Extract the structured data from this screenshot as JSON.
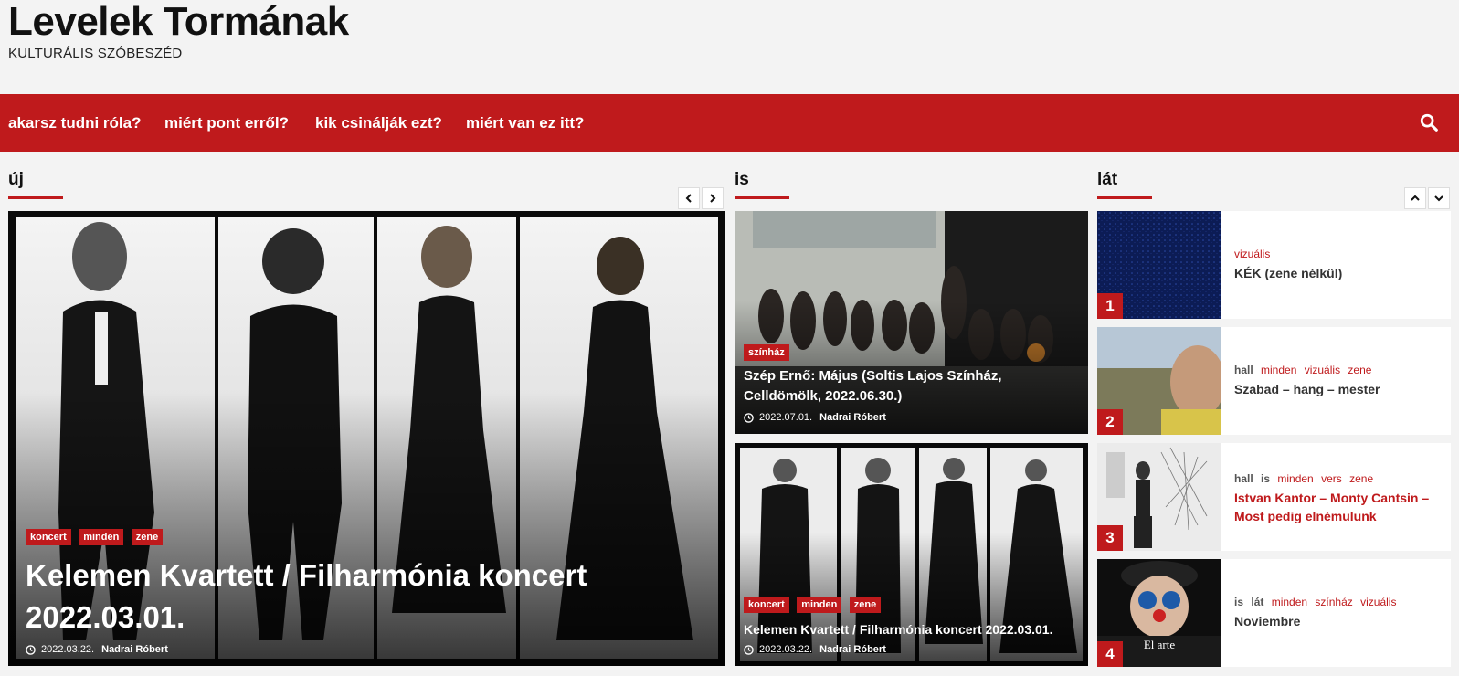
{
  "site": {
    "title": "Levelek Tormának",
    "tagline": "KULTURÁLIS SZÓBESZÉD"
  },
  "nav": {
    "items": [
      {
        "label": "akarsz tudni róla?"
      },
      {
        "label": "miért pont erről?"
      },
      {
        "label": "kik csinálják ezt?"
      },
      {
        "label": "miért van ez itt?"
      }
    ],
    "search_icon": "search-icon"
  },
  "colors": {
    "accent": "#bf1a1c",
    "background": "#f3f3f3"
  },
  "sections": {
    "uj": {
      "title": "új",
      "featured": {
        "tags": [
          "koncert",
          "minden",
          "zene"
        ],
        "headline": "Kelemen Kvartett / Filharmónia koncert 2022.03.01.",
        "date": "2022.03.22.",
        "author": "Nadrai Róbert"
      }
    },
    "is": {
      "title": "is",
      "posts": [
        {
          "tags": [
            "színház"
          ],
          "headline": "Szép Ernő: Május (Soltis Lajos Színház, Celldömölk, 2022.06.30.)",
          "date": "2022.07.01.",
          "author": "Nadrai Róbert"
        },
        {
          "tags": [
            "koncert",
            "minden",
            "zene"
          ],
          "headline": "Kelemen Kvartett / Filharmónia koncert 2022.03.01.",
          "date": "2022.03.22.",
          "author": "Nadrai Róbert"
        }
      ]
    },
    "lat": {
      "title": "lát",
      "items": [
        {
          "num": "1",
          "grey": [],
          "red": [
            "vizuális"
          ],
          "title": "KÉK (zene nélkül)"
        },
        {
          "num": "2",
          "grey": [
            "hall"
          ],
          "red": [
            "minden",
            "vizuális",
            "zene"
          ],
          "title": "Szabad – hang – mester"
        },
        {
          "num": "3",
          "grey": [
            "hall",
            "is"
          ],
          "red": [
            "minden",
            "vers",
            "zene"
          ],
          "title": "Istvan Kantor – Monty Cantsin – Most pedig elnémulunk"
        },
        {
          "num": "4",
          "grey": [
            "is",
            "lát"
          ],
          "red": [
            "minden",
            "színház",
            "vizuális"
          ],
          "title": "Noviembre",
          "caption": "El arte"
        }
      ]
    }
  }
}
